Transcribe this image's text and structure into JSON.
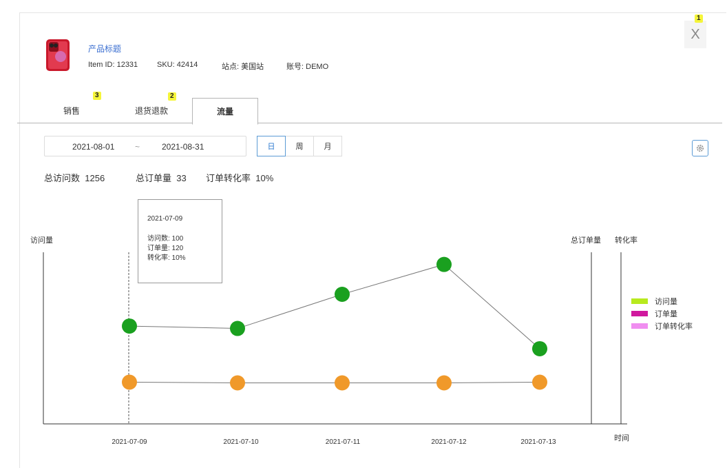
{
  "product": {
    "title": "产品标题",
    "item_id_label": "Item ID:",
    "item_id": "12331",
    "sku_label": "SKU:",
    "sku": "42414",
    "site_label": "站点:",
    "site": "美国站",
    "account_label": "账号:",
    "account": "DEMO",
    "thumbnail_icon": "iphone-icon"
  },
  "close_label": "X",
  "annotation_badges": [
    "1",
    "2",
    "3"
  ],
  "tabs": [
    {
      "label": "销售",
      "active": false
    },
    {
      "label": "退货退款",
      "active": false
    },
    {
      "label": "流量",
      "active": true
    }
  ],
  "date_range": {
    "start": "2021-08-01",
    "separator": "~",
    "end": "2021-08-31"
  },
  "granularity": [
    {
      "label": "日",
      "active": true
    },
    {
      "label": "周",
      "active": false
    },
    {
      "label": "月",
      "active": false
    }
  ],
  "settings_icon": "gear-icon",
  "stats": {
    "visits_label": "总访问数",
    "visits": "1256",
    "orders_label": "总订单量",
    "orders": "33",
    "rate_label": "订单转化率",
    "rate": "10%"
  },
  "tooltip": {
    "date": "2021-07-09",
    "rows": [
      "访问数: 100",
      "订单量: 120",
      "转化率: 10%"
    ]
  },
  "colors": {
    "visits_marker": "#1aa01f",
    "orders_marker": "#f0992a",
    "legend_visits": "#b8ea1e",
    "legend_orders": "#d0199e",
    "legend_rate": "#f08ef0"
  },
  "chart_data": {
    "type": "line",
    "title": "",
    "categories": [
      "2021-07-09",
      "2021-07-10",
      "2021-07-11",
      "2021-07-12",
      "2021-07-13"
    ],
    "xlabel": "时间",
    "ylabel_left": "访问量",
    "ylabel_right": [
      "总订单量",
      "转化率"
    ],
    "legend": [
      "访问量",
      "订单量",
      "订单转化率"
    ],
    "legend_position": "right",
    "grid": false,
    "series": [
      {
        "name": "访问量",
        "color": "#1aa01f",
        "values": [
          0.57,
          0.556,
          0.755,
          0.929,
          0.438
        ]
      },
      {
        "name": "订单量",
        "color": "#f0992a",
        "values": [
          0.243,
          0.239,
          0.239,
          0.239,
          0.243
        ]
      }
    ],
    "note_values": "no axis tick values shown; values expressed as fraction of plot height"
  }
}
